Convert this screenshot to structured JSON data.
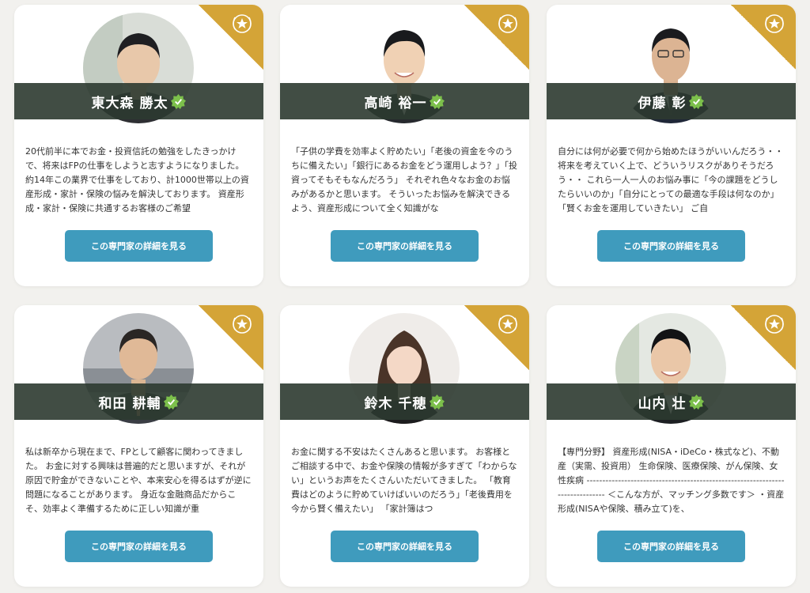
{
  "colors": {
    "background": "#f2f1ee",
    "card": "#ffffff",
    "ribbon": "#d4a437",
    "name_band": "#2c3a30",
    "cta": "#3f9bbd",
    "verified": "#7cc04b"
  },
  "cta_label": "この専門家の詳細を見る",
  "experts": [
    {
      "name": "東大森 勝太",
      "description": "20代前半に本でお金・投資信託の勉強をしたきっかけで、将来はFPの仕事をしようと志すようになりました。 約14年この業界で仕事をしており、計1000世帯以上の資産形成・家計・保険の悩みを解決しております。 資産形成・家計・保険に共通するお客様のご希望",
      "avatar_icon": "person-photo-icon"
    },
    {
      "name": "高崎 裕一",
      "description": "「子供の学費を効率よく貯めたい」「老後の資金を今のうちに備えたい」「銀行にあるお金をどう運用しよう？」「投資ってそもそもなんだろう」 それぞれ色々なお金のお悩みがあるかと思います。 そういったお悩みを解決できるよう、資産形成について全く知識がな",
      "avatar_icon": "person-photo-icon"
    },
    {
      "name": "伊藤 彰",
      "description": "自分には何が必要で何から始めたほうがいいんだろう・・ 将来を考えていく上で、どういうリスクがありそうだろう・・ これら一人一人のお悩み事に「今の課題をどうしたらいいのか」「自分にとっての最適な手段は何なのか」「賢くお金を運用していきたい」 ご自",
      "avatar_icon": "person-photo-icon"
    },
    {
      "name": "和田 耕輔",
      "description": "私は新卒から現在まで、FPとして顧客に関わってきました。 お金に対する興味は普遍的だと思いますが、それが原因で貯金ができないことや、本来安心を得るはずが逆に問題になることがあります。 身近な金融商品だからこそ、効率よく準備するために正しい知識が重",
      "avatar_icon": "person-photo-icon"
    },
    {
      "name": "鈴木 千穂",
      "description": "お金に関する不安はたくさんあると思います。 お客様とご相談する中で、お金や保険の情報が多すぎて「わからない」というお声をたくさんいただいてきました。 「教育費はどのように貯めていけばいいのだろう」「老後費用を今から賢く備えたい」 「家計簿はつ",
      "avatar_icon": "person-photo-icon"
    },
    {
      "name": "山内 壮",
      "description": "【専門分野】 資産形成(NISA・iDeCo・株式など)、不動産（実需、投資用） 生命保険、医療保険、がん保険、女性疾病 ------------------------------------------------------------------------------ ＜こんな方が、マッチング多数です＞ ・資産形成(NISAや保険、積み立て)を、",
      "avatar_icon": "person-photo-icon"
    }
  ]
}
